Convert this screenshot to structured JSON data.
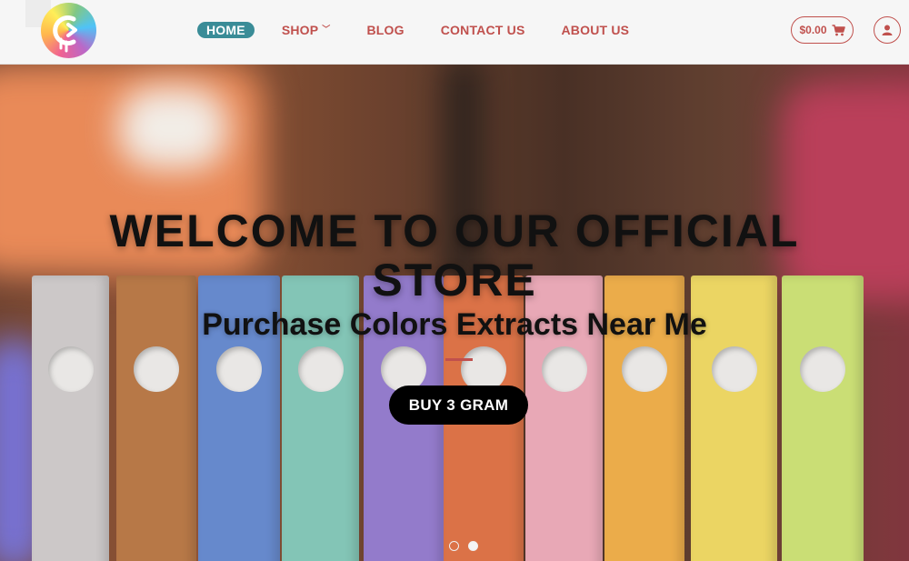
{
  "header": {
    "nav": [
      {
        "label": "HOME",
        "active": true
      },
      {
        "label": "SHOP",
        "has_dropdown": true
      },
      {
        "label": "BLOG"
      },
      {
        "label": "CONTACT US"
      },
      {
        "label": "ABOUT US"
      }
    ],
    "cart_total": "$0.00"
  },
  "hero": {
    "headline_line1": "WELCOME TO OUR OFFICIAL",
    "headline_line2": "STORE",
    "subheadline": "Purchase Colors Extracts Near Me",
    "cta_label": "BUY 3 GRAM",
    "slides": 2,
    "active_slide": 2
  },
  "colors": {
    "accent": "#c0504d",
    "nav_active_bg": "#3a8c97",
    "cta_bg": "#000000"
  },
  "icons": {
    "cart": "shopping-cart-icon",
    "account": "user-icon",
    "dropdown": "chevron-down-icon"
  }
}
